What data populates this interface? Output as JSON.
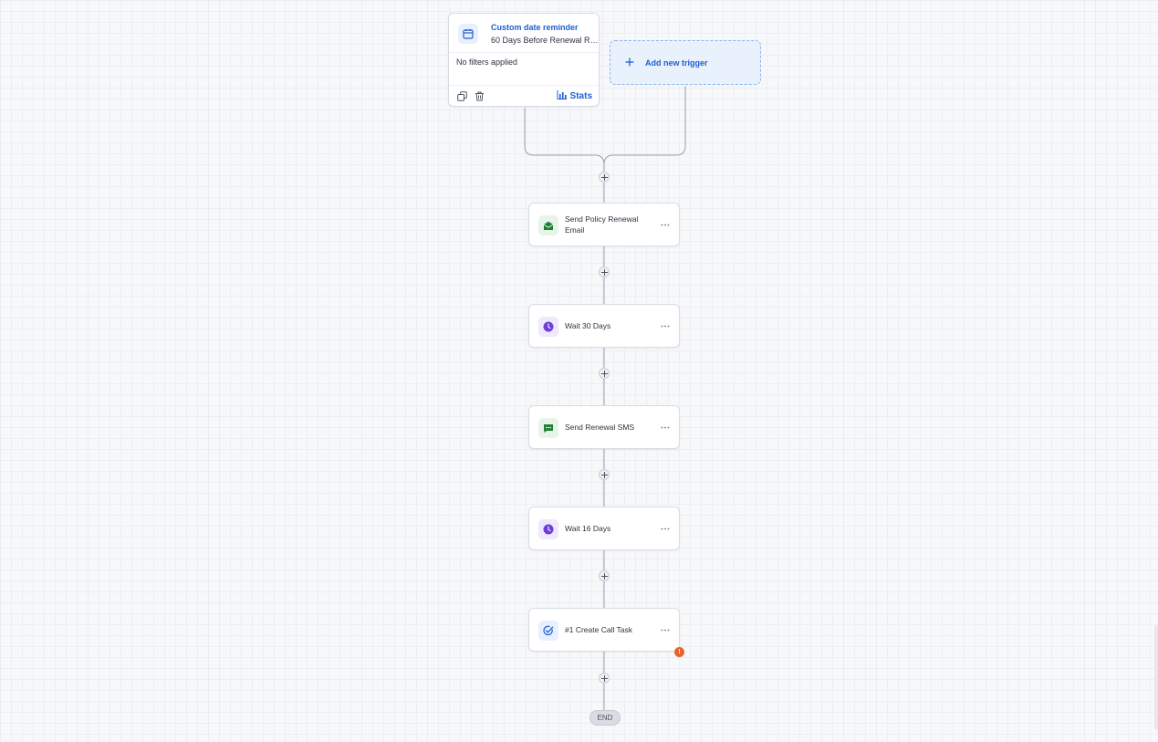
{
  "trigger": {
    "title": "Custom date reminder",
    "subtitle": "60 Days Before Renewal Re...",
    "filter_text": "No filters applied",
    "copy_icon": "copy-icon",
    "delete_icon": "trash-icon",
    "stats_label": "Stats"
  },
  "add_trigger": {
    "label": "Add new trigger"
  },
  "actions": [
    {
      "label": "Send Policy Renewal Email",
      "icon": "email-icon"
    },
    {
      "label": "Wait 30 Days",
      "icon": "clock-icon"
    },
    {
      "label": "Send Renewal SMS",
      "icon": "sms-icon"
    },
    {
      "label": "Wait 16 Days",
      "icon": "clock-icon"
    },
    {
      "label": "#1 Create Call Task",
      "icon": "task-icon",
      "has_error": true
    }
  ],
  "error_badge": "!",
  "end_label": "END",
  "colors": {
    "accent": "#1d5fd0",
    "email_green": "#1e7e34",
    "wait_purple": "#6d3fd6",
    "error_orange": "#e8622c"
  }
}
